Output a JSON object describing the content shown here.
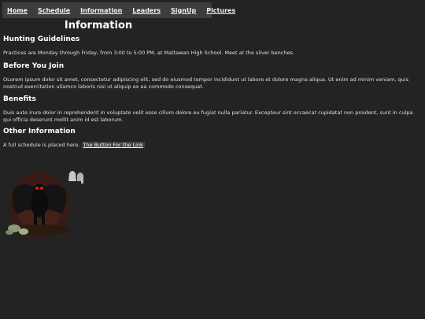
{
  "nav": {
    "items": [
      {
        "label": "Home"
      },
      {
        "label": "Schedule"
      },
      {
        "label": "Information"
      },
      {
        "label": "Leaders"
      },
      {
        "label": "SignUp"
      },
      {
        "label": "Pictures"
      }
    ]
  },
  "main": {
    "title": "Information",
    "sections": [
      {
        "heading": "Hunting Guidelines",
        "text": "Practices are Monday through Friday, from 3:00 to 5:00 PM, at Mattawan High School. Meet at the silver benches."
      },
      {
        "heading": "Before You Join",
        "text": "OLorem ipsum dolor sit amet, consectetur adipiscing elit, sed do eiusmod tempor incididunt ut labore et dolore magna aliqua. Ut enim ad minim veniam, quis nostrud exercitation ullamco laboris nisi ut aliquip ex ea commodo consequat."
      },
      {
        "heading": "Benefits",
        "text": "Duis aute irure dolor in reprehenderit in voluptate velit esse cillum dolore eu fugiat nulla pariatur. Excepteur sint occaecat cupidatat non proident, sunt in culpa qui officia deserunt mollit anim id est laborum."
      },
      {
        "heading": "Other Information",
        "text": "A full schedule is placed here.",
        "link_label": "The Button For the Link"
      }
    ]
  },
  "colors": {
    "background": "#232323",
    "navbar": "#3d3d3d",
    "text": "#e8e8e8"
  }
}
